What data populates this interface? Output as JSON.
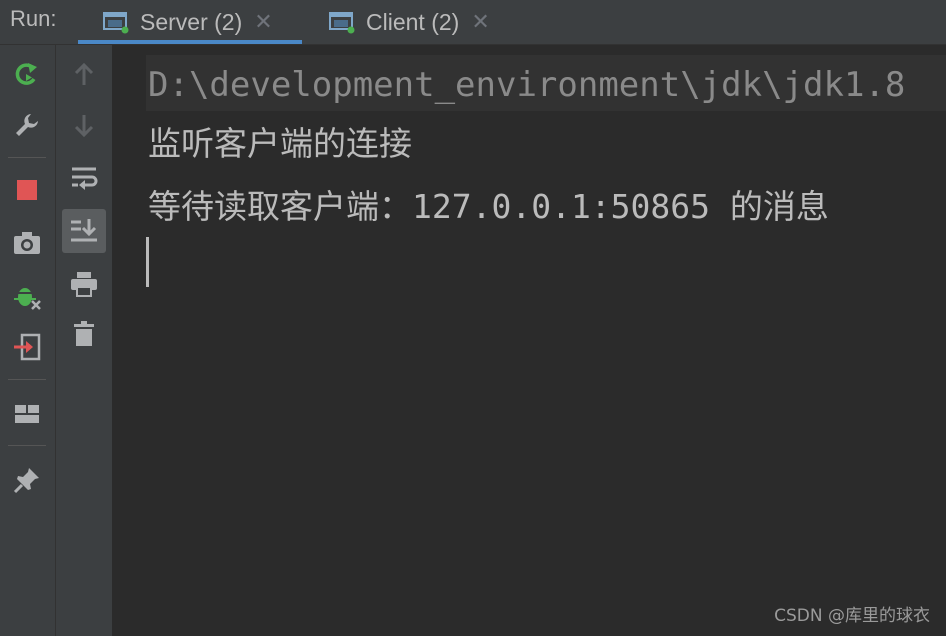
{
  "header": {
    "run_label": "Run:",
    "tabs": [
      {
        "label": "Server (2)",
        "active": true
      },
      {
        "label": "Client (2)",
        "active": false
      }
    ]
  },
  "left_toolbar": {
    "icons": [
      "rerun-icon",
      "wrench-icon",
      "stop-icon",
      "camera-icon",
      "debug-bug-icon",
      "exit-icon",
      "layout-icon",
      "pin-icon"
    ]
  },
  "mid_toolbar": {
    "icons": [
      "arrow-up-icon",
      "arrow-down-icon",
      "soft-wrap-icon",
      "scroll-to-end-icon",
      "print-icon",
      "trash-icon"
    ]
  },
  "console": {
    "command": "D:\\development_environment\\jdk\\jdk1.8",
    "lines": [
      "监听客户端的连接",
      "等待读取客户端：127.0.0.1:50865 的消息"
    ]
  },
  "watermark": "CSDN @库里的球衣",
  "colors": {
    "accent": "#4a88c7",
    "green": "#4caf50",
    "red": "#e05555",
    "panel": "#3c3f41",
    "editor": "#2b2b2b"
  }
}
